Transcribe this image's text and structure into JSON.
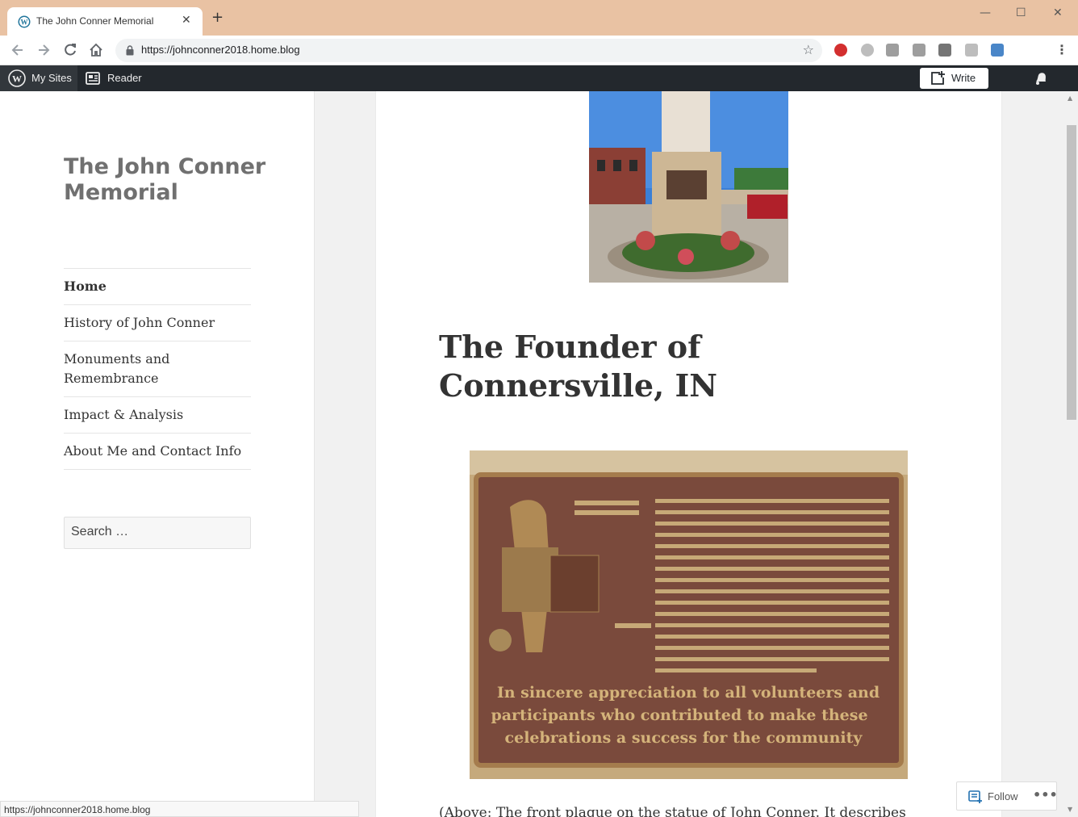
{
  "browser": {
    "tab_title": "The John Conner Memorial",
    "tab_close": "✕",
    "new_tab": "+",
    "url": "https://johnconner2018.home.blog",
    "window_controls": [
      "—",
      "☐",
      "✕"
    ],
    "star_icon": "☆",
    "menu_dots": "⋮"
  },
  "wp_bar": {
    "my_sites": "My Sites",
    "reader": "Reader",
    "write": "Write"
  },
  "site": {
    "title": "The John Conner Memorial",
    "nav": [
      {
        "label": "Home"
      },
      {
        "label": "History of John Conner"
      },
      {
        "label": "Monuments and Remembrance"
      },
      {
        "label": "Impact & Analysis"
      },
      {
        "label": "About Me and Contact Info"
      }
    ],
    "search_placeholder": "Search …"
  },
  "post": {
    "title": "The Founder of Connersville, IN",
    "caption": "(Above: The front plaque on the statue of John Conner. It describes"
  },
  "plaque": {
    "inscription": "In sincere appreciation to all volunteers and participants who contributed to make these celebrations a success for the community"
  },
  "follow": {
    "label": "Follow",
    "dots": "•••"
  },
  "status_bar": {
    "text": "https://johnconner2018.home.blog"
  },
  "colors": {
    "tab_bar": "#e9c2a3",
    "wp_bar": "#23282d",
    "page_bg": "#f1f1f1"
  }
}
